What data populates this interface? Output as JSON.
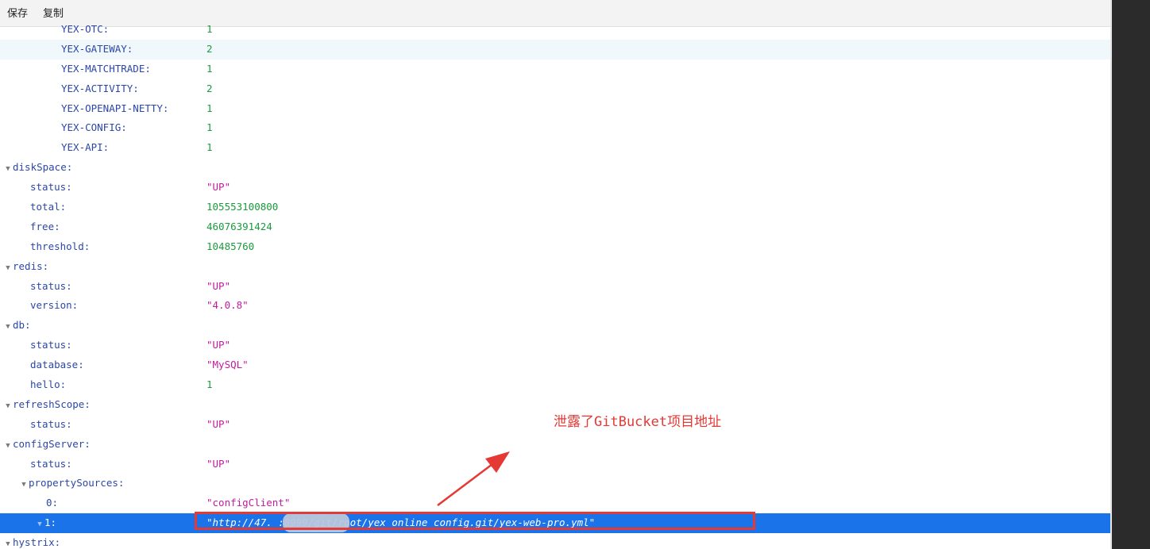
{
  "toolbar": {
    "save_label": "保存",
    "copy_label": "复制"
  },
  "rows": [
    {
      "key": "YEX-OTC:",
      "value": "1",
      "type": "num",
      "indent": 77,
      "twisty": false
    },
    {
      "key": "YEX-GATEWAY:",
      "value": "2",
      "type": "num",
      "indent": 77,
      "twisty": false,
      "state": "hover"
    },
    {
      "key": "YEX-MATCHTRADE:",
      "value": "1",
      "type": "num",
      "indent": 77,
      "twisty": false
    },
    {
      "key": "YEX-ACTIVITY:",
      "value": "2",
      "type": "num",
      "indent": 77,
      "twisty": false
    },
    {
      "key": "YEX-OPENAPI-NETTY:",
      "value": "1",
      "type": "num",
      "indent": 77,
      "twisty": false
    },
    {
      "key": "YEX-CONFIG:",
      "value": "1",
      "type": "num",
      "indent": 77,
      "twisty": false
    },
    {
      "key": "YEX-API:",
      "value": "1",
      "type": "num",
      "indent": 77,
      "twisty": false
    },
    {
      "key": "diskSpace:",
      "value": "",
      "type": "none",
      "indent": 4,
      "twisty": true
    },
    {
      "key": "status:",
      "value": "\"UP\"",
      "type": "str",
      "indent": 38,
      "twisty": false
    },
    {
      "key": "total:",
      "value": "105553100800",
      "type": "num",
      "indent": 38,
      "twisty": false
    },
    {
      "key": "free:",
      "value": "46076391424",
      "type": "num",
      "indent": 38,
      "twisty": false
    },
    {
      "key": "threshold:",
      "value": "10485760",
      "type": "num",
      "indent": 38,
      "twisty": false
    },
    {
      "key": "redis:",
      "value": "",
      "type": "none",
      "indent": 4,
      "twisty": true
    },
    {
      "key": "status:",
      "value": "\"UP\"",
      "type": "str",
      "indent": 38,
      "twisty": false
    },
    {
      "key": "version:",
      "value": "\"4.0.8\"",
      "type": "str",
      "indent": 38,
      "twisty": false
    },
    {
      "key": "db:",
      "value": "",
      "type": "none",
      "indent": 4,
      "twisty": true
    },
    {
      "key": "status:",
      "value": "\"UP\"",
      "type": "str",
      "indent": 38,
      "twisty": false
    },
    {
      "key": "database:",
      "value": "\"MySQL\"",
      "type": "str",
      "indent": 38,
      "twisty": false
    },
    {
      "key": "hello:",
      "value": "1",
      "type": "num",
      "indent": 38,
      "twisty": false
    },
    {
      "key": "refreshScope:",
      "value": "",
      "type": "none",
      "indent": 4,
      "twisty": true
    },
    {
      "key": "status:",
      "value": "\"UP\"",
      "type": "str",
      "indent": 38,
      "twisty": false
    },
    {
      "key": "configServer:",
      "value": "",
      "type": "none",
      "indent": 4,
      "twisty": true
    },
    {
      "key": "status:",
      "value": "\"UP\"",
      "type": "str",
      "indent": 38,
      "twisty": false
    },
    {
      "key": "propertySources:",
      "value": "",
      "type": "none",
      "indent": 24,
      "twisty": true
    },
    {
      "key": "0:",
      "value": "\"configClient\"",
      "type": "str",
      "indent": 58,
      "twisty": false
    },
    {
      "key": "1:",
      "value": "\"http://47.          :8999/git/root/yex_online_config.git/yex-web-pro.yml\"",
      "type": "str",
      "indent": 44,
      "twisty": true,
      "state": "selected"
    },
    {
      "key": "hystrix:",
      "value": "",
      "type": "none",
      "indent": 4,
      "twisty": true
    }
  ],
  "annotation": {
    "text": "泄露了GitBucket项目地址",
    "color": "#e53935"
  },
  "colors": {
    "key": "#2b47a8",
    "number": "#1a9c3c",
    "string": "#c41a9c",
    "selected_bg": "#1a73e8",
    "hover_bg": "#f0f8fc"
  },
  "icons": {
    "twisty": "triangle-down-icon"
  }
}
